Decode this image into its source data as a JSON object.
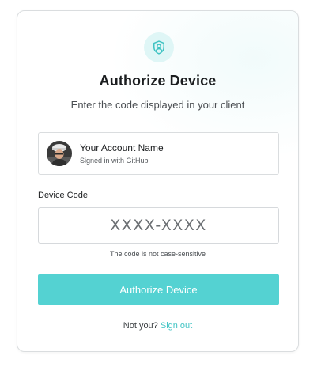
{
  "card": {
    "title": "Authorize Device",
    "subtitle": "Enter the code displayed in your client"
  },
  "logo": {
    "icon": "shield-user-icon",
    "color": "#3fc3c3"
  },
  "account": {
    "name": "Your Account Name",
    "subtitle": "Signed in with GitHub"
  },
  "device_code": {
    "label": "Device Code",
    "placeholder": "XXXX-XXXX",
    "value": "",
    "hint": "The code is not case-sensitive"
  },
  "authorize_button": {
    "label": "Authorize Device",
    "color": "#54d2d2"
  },
  "footer": {
    "prompt": "Not you?",
    "link": "Sign out"
  }
}
